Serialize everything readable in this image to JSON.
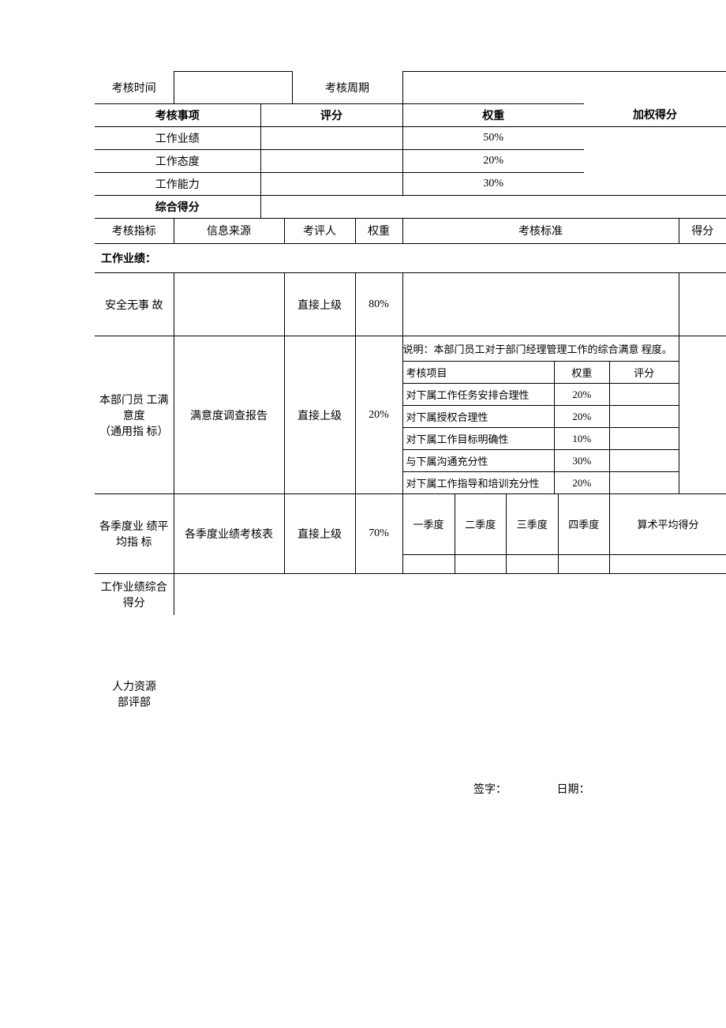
{
  "header": {
    "time_label": "考核时间",
    "cycle_label": "考核周期",
    "time_value": "",
    "cycle_value": ""
  },
  "summary": {
    "col_item": "考核事项",
    "col_score": "评分",
    "col_weight": "权重",
    "col_weighted": "加权得分",
    "rows": [
      {
        "item": "工作业绩",
        "score": "",
        "weight": "50%",
        "weighted": ""
      },
      {
        "item": "工作态度",
        "score": "",
        "weight": "20%",
        "weighted": ""
      },
      {
        "item": "工作能力",
        "score": "",
        "weight": "30%",
        "weighted": ""
      }
    ],
    "total_label": "综合得分",
    "total_value": ""
  },
  "detail_header": {
    "metric": "考核指标",
    "source": "信息来源",
    "evaluator": "考评人",
    "weight": "权重",
    "standard": "考核标准",
    "score": "得分"
  },
  "section1_title": "工作业绩：",
  "row_safety": {
    "metric": "安全无事 故",
    "source": "",
    "evaluator": "直接上级",
    "weight": "80%",
    "standard": "",
    "score": ""
  },
  "row_satisfaction": {
    "metric": "本部门员 工满意度\n（通用指 标）",
    "source": "满意度调查报告",
    "evaluator": "直接上级",
    "weight": "20%",
    "description": "说明：本部门员工对于部门经理管理工作的综合满意 程度。",
    "inner_header": {
      "item": "考核项目",
      "weight_h": "权重",
      "score_h": "评分"
    },
    "inner_rows": [
      {
        "item": "对下属工作任务安排合理性",
        "w": "20%",
        "s": ""
      },
      {
        "item": "对下属授权合理性",
        "w": "20%",
        "s": ""
      },
      {
        "item": "对下属工作目标明确性",
        "w": "10%",
        "s": ""
      },
      {
        "item": "与下属沟通充分性",
        "w": "30%",
        "s": ""
      },
      {
        "item": "对下属工作指导和培训充分性",
        "w": "20%",
        "s": ""
      }
    ],
    "score": ""
  },
  "row_quarter": {
    "metric": "各季度业 绩平均指 标",
    "source": "各季度业绩考核表",
    "evaluator": "直接上级",
    "weight": "70%",
    "cols": {
      "q1": "一季度",
      "q2": "二季度",
      "q3": "三季度",
      "q4": "四季度",
      "avg": "算术平均得分"
    },
    "vals": {
      "q1": "",
      "q2": "",
      "q3": "",
      "q4": "",
      "avg": ""
    },
    "score": ""
  },
  "row_total": {
    "label": "工作业绩综合得分",
    "value": ""
  },
  "footer": {
    "hr_label": "人力资源部评部",
    "sign_label": "签字：",
    "date_label": "日期："
  }
}
